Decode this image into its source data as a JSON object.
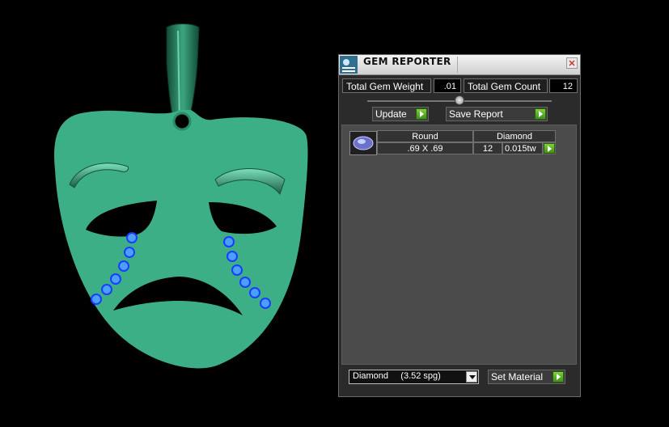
{
  "panel": {
    "title": "GEM REPORTER",
    "total_gem_weight_label": "Total Gem Weight",
    "total_gem_weight_value": ".01",
    "total_gem_count_label": "Total Gem Count",
    "total_gem_count_value": "12",
    "update_label": "Update",
    "save_report_label": "Save Report",
    "gem_row": {
      "shape": "Round",
      "material": "Diamond",
      "size": ".69 X .69",
      "count": "12",
      "weight": "0.015tw"
    },
    "material_select": "Diamond     (3.52 spg)",
    "set_material_label": "Set Material"
  },
  "colors": {
    "mask_green": "#3daf87",
    "mask_dark": "#1f6b50",
    "gem_blue": "#3a6cff",
    "go_green": "#5fb02a"
  }
}
